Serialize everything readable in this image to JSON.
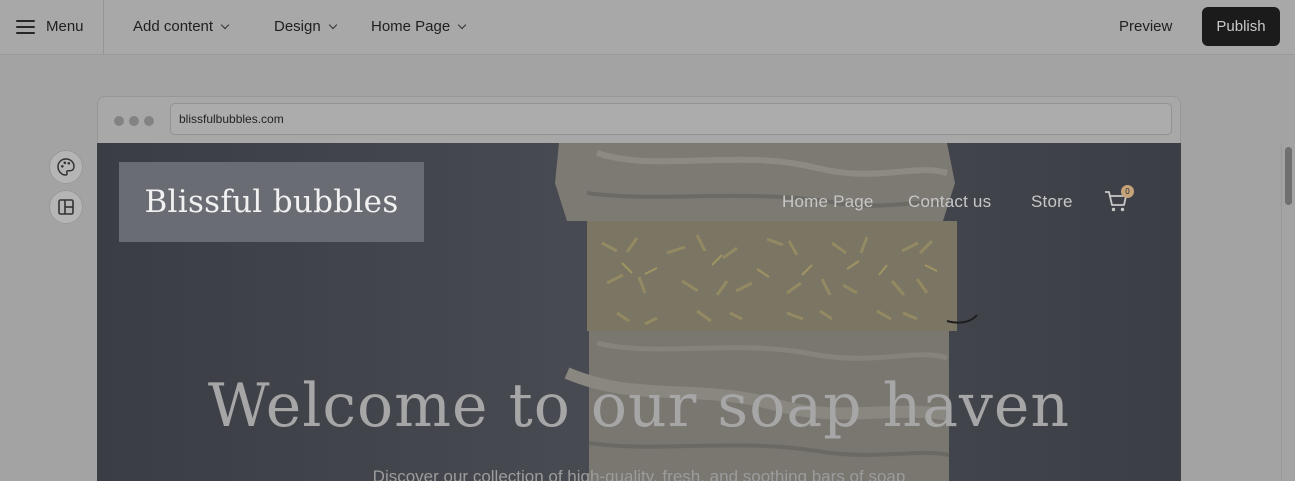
{
  "editor": {
    "menu_label": "Menu",
    "nav": [
      {
        "label": "Add content"
      },
      {
        "label": "Design"
      },
      {
        "label": "Home Page"
      }
    ],
    "preview_label": "Preview",
    "publish_label": "Publish"
  },
  "side_tools": [
    {
      "icon": "palette-icon"
    },
    {
      "icon": "layout-icon"
    }
  ],
  "browser": {
    "url": "blissfulbubbles.com"
  },
  "site": {
    "logo": "Blissful bubbles",
    "nav": [
      "Home Page",
      "Contact us",
      "Store"
    ],
    "cart_count": "0",
    "hero_title": "Welcome to our soap haven",
    "hero_subtitle": "Discover our collection of high-quality, fresh, and soothing bars of soap"
  },
  "colors": {
    "overlay": "#a3a3a3",
    "publish_bg": "#1b1b1b",
    "cart_badge": "#c5a37a"
  }
}
